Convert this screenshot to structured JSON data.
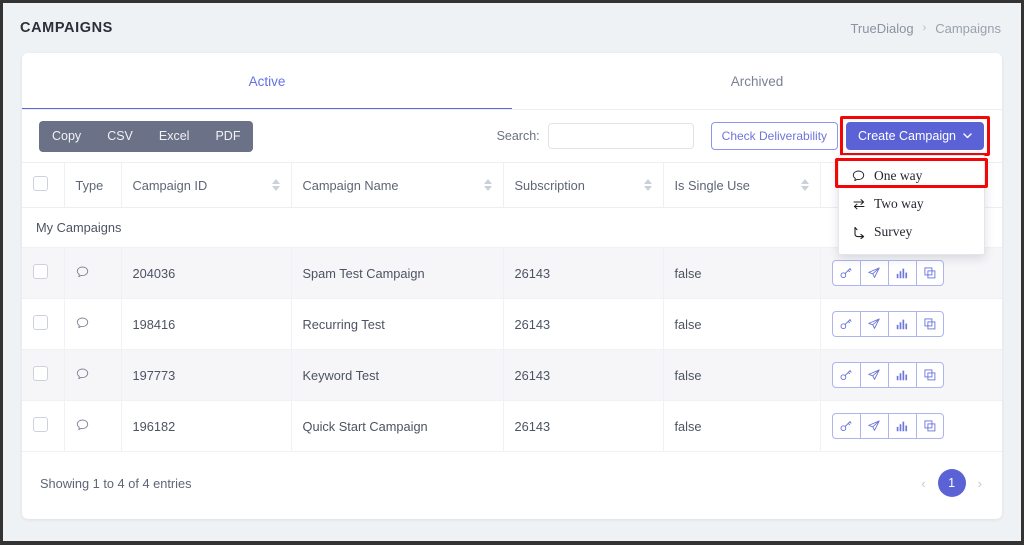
{
  "header": {
    "title": "CAMPAIGNS",
    "breadcrumb": {
      "root": "TrueDialog",
      "separator": "›",
      "current": "Campaigns"
    }
  },
  "tabs": [
    {
      "label": "Active",
      "active": true
    },
    {
      "label": "Archived",
      "active": false
    }
  ],
  "toolbar": {
    "export_buttons": [
      "Copy",
      "CSV",
      "Excel",
      "PDF"
    ],
    "search_label": "Search:",
    "search_value": "",
    "search_placeholder": "",
    "check_deliverability_label": "Check Deliverability",
    "create_campaign_label": "Create Campaign",
    "create_campaign_caret": "⌄"
  },
  "dropdown": {
    "open": true,
    "items": [
      {
        "label": "One way",
        "icon": "speech-bubble-icon",
        "highlighted": true
      },
      {
        "label": "Two way",
        "icon": "two-way-arrows-icon",
        "highlighted": false
      },
      {
        "label": "Survey",
        "icon": "branch-arrow-icon",
        "highlighted": false
      }
    ]
  },
  "table": {
    "columns": [
      {
        "label": "",
        "sortable": false
      },
      {
        "label": "Type",
        "sortable": false
      },
      {
        "label": "Campaign ID",
        "sortable": true
      },
      {
        "label": "Campaign Name",
        "sortable": true
      },
      {
        "label": "Subscription",
        "sortable": true
      },
      {
        "label": "Is Single Use",
        "sortable": true
      },
      {
        "label": "",
        "sortable": false
      }
    ],
    "group_label": "My Campaigns",
    "rows": [
      {
        "id": "204036",
        "name": "Spam Test Campaign",
        "subscription": "26143",
        "single_use": "false"
      },
      {
        "id": "198416",
        "name": "Recurring Test",
        "subscription": "26143",
        "single_use": "false"
      },
      {
        "id": "197773",
        "name": "Keyword Test",
        "subscription": "26143",
        "single_use": "false"
      },
      {
        "id": "196182",
        "name": "Quick Start Campaign",
        "subscription": "26143",
        "single_use": "false"
      }
    ],
    "row_actions": [
      "key-icon",
      "send-icon",
      "bar-chart-icon",
      "duplicate-icon"
    ]
  },
  "footer": {
    "entries_info": "Showing 1 to 4 of 4 entries",
    "prev_label": "‹",
    "next_label": "›",
    "current_page": "1"
  },
  "colors": {
    "accent": "#5b62d6",
    "link": "#6c77d9",
    "export_bar": "#6b7186",
    "highlight": "#f40606",
    "page_bg": "#eef2f5"
  }
}
